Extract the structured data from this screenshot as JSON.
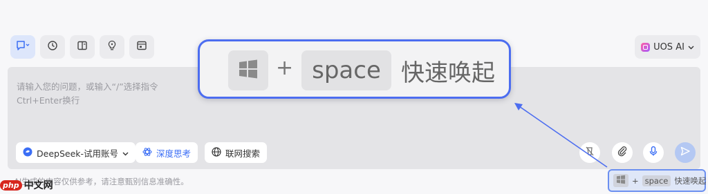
{
  "toolbar": {
    "buttons": [
      {
        "name": "new-chat-icon"
      },
      {
        "name": "history-icon"
      },
      {
        "name": "sidebar-panel-icon"
      },
      {
        "name": "tips-bulb-icon"
      },
      {
        "name": "agent-window-icon"
      }
    ],
    "model_switch": {
      "label": "UOS AI",
      "icon": "uos-ai-logo"
    }
  },
  "input": {
    "placeholder_line1": "请输入您的问题，或输入“/”选择指令",
    "placeholder_line2": "Ctrl+Enter换行"
  },
  "controls": {
    "model_select": "DeepSeek-试用账号",
    "deep_think": "深度思考",
    "web_search": "联网搜索",
    "right_icons": [
      "clear-disabled-icon",
      "attachment-icon",
      "microphone-icon",
      "send-icon"
    ]
  },
  "disclaimer": "AI生成的内容仅供参考，请注意甄别信息准确性。",
  "watermark": {
    "badge": "php",
    "text": "中文网"
  },
  "shortcut_popup": {
    "plus": "+",
    "key": "space",
    "action": "快速唤起"
  },
  "shortcut_mini": {
    "plus": "+",
    "key": "space",
    "action": "快速唤起"
  },
  "colors": {
    "accent": "#4c6df0",
    "send_disabled": "#b4c8f3",
    "deep_think_text": "#3b6ef5"
  }
}
